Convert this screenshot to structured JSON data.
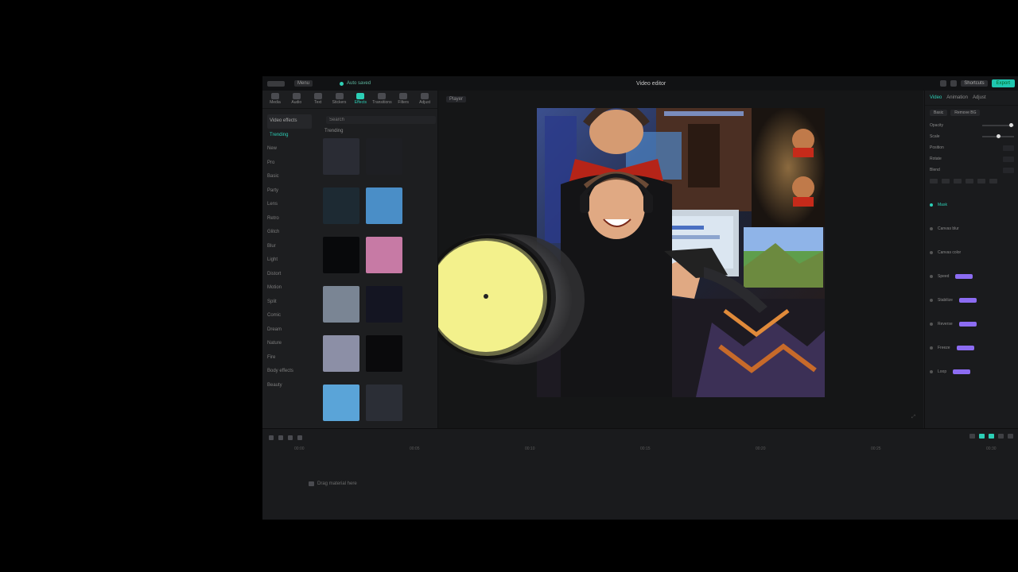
{
  "app": {
    "menu_label": "Menu",
    "status_text": "Auto saved",
    "project_title": "Video editor",
    "shortcuts_label": "Shortcuts",
    "export_label": "Export",
    "accent_color": "#2ccfb6"
  },
  "toolbar": {
    "tools": [
      {
        "label": "Media",
        "icon": "media-icon"
      },
      {
        "label": "Audio",
        "icon": "audio-icon"
      },
      {
        "label": "Text",
        "icon": "text-icon"
      },
      {
        "label": "Stickers",
        "icon": "sticker-icon"
      },
      {
        "label": "Effects",
        "icon": "effects-icon",
        "active": true
      },
      {
        "label": "Transitions",
        "icon": "transition-icon"
      },
      {
        "label": "Filters",
        "icon": "filter-icon"
      },
      {
        "label": "Adjust",
        "icon": "adjust-icon"
      }
    ]
  },
  "media_panel": {
    "categories": [
      "Video effects",
      "Trending",
      "New",
      "Pro",
      "Basic",
      "Party",
      "Lens",
      "Retro",
      "Glitch",
      "Blur",
      "Light",
      "Distort",
      "Motion",
      "Split",
      "Comic",
      "Dream",
      "Nature",
      "Fire",
      "Body effects",
      "Beauty"
    ],
    "search_placeholder": "Search",
    "grid_label": "Trending",
    "thumbnails": [
      {
        "name": "effect-thumb-1",
        "color": "#2a2c34"
      },
      {
        "name": "effect-thumb-2",
        "color": "#1e1f23"
      },
      {
        "name": "effect-thumb-3",
        "color": "#1d2a33"
      },
      {
        "name": "effect-thumb-4",
        "color": "#4a8ec7"
      },
      {
        "name": "effect-thumb-5",
        "color": "#08090b"
      },
      {
        "name": "effect-thumb-6",
        "color": "#c77aa5"
      },
      {
        "name": "effect-thumb-7",
        "color": "#7a8594"
      },
      {
        "name": "effect-thumb-8",
        "color": "#141522"
      },
      {
        "name": "effect-thumb-9",
        "color": "#8c8fa6"
      },
      {
        "name": "effect-thumb-10",
        "color": "#0a0a0c"
      },
      {
        "name": "effect-thumb-11",
        "color": "#5aa4d8"
      },
      {
        "name": "effect-thumb-12",
        "color": "#2b2e36"
      }
    ]
  },
  "player": {
    "label": "Player"
  },
  "inspector": {
    "tabs": [
      "Video",
      "Animation",
      "Adjust"
    ],
    "sub_tabs": [
      "Basic",
      "Remove BG"
    ],
    "rows": [
      "Opacity",
      "Scale",
      "Position",
      "Rotate",
      "Blend"
    ],
    "animations": [
      "Mask",
      "Canvas blur",
      "Canvas color",
      "Speed",
      "Stabilize",
      "Reverse",
      "Freeze",
      "Loop"
    ]
  },
  "timeline": {
    "ruler": [
      "00:00",
      "00:05",
      "00:10",
      "00:15",
      "00:20",
      "00:25",
      "00:30"
    ],
    "track_hint": "Drag material here"
  }
}
